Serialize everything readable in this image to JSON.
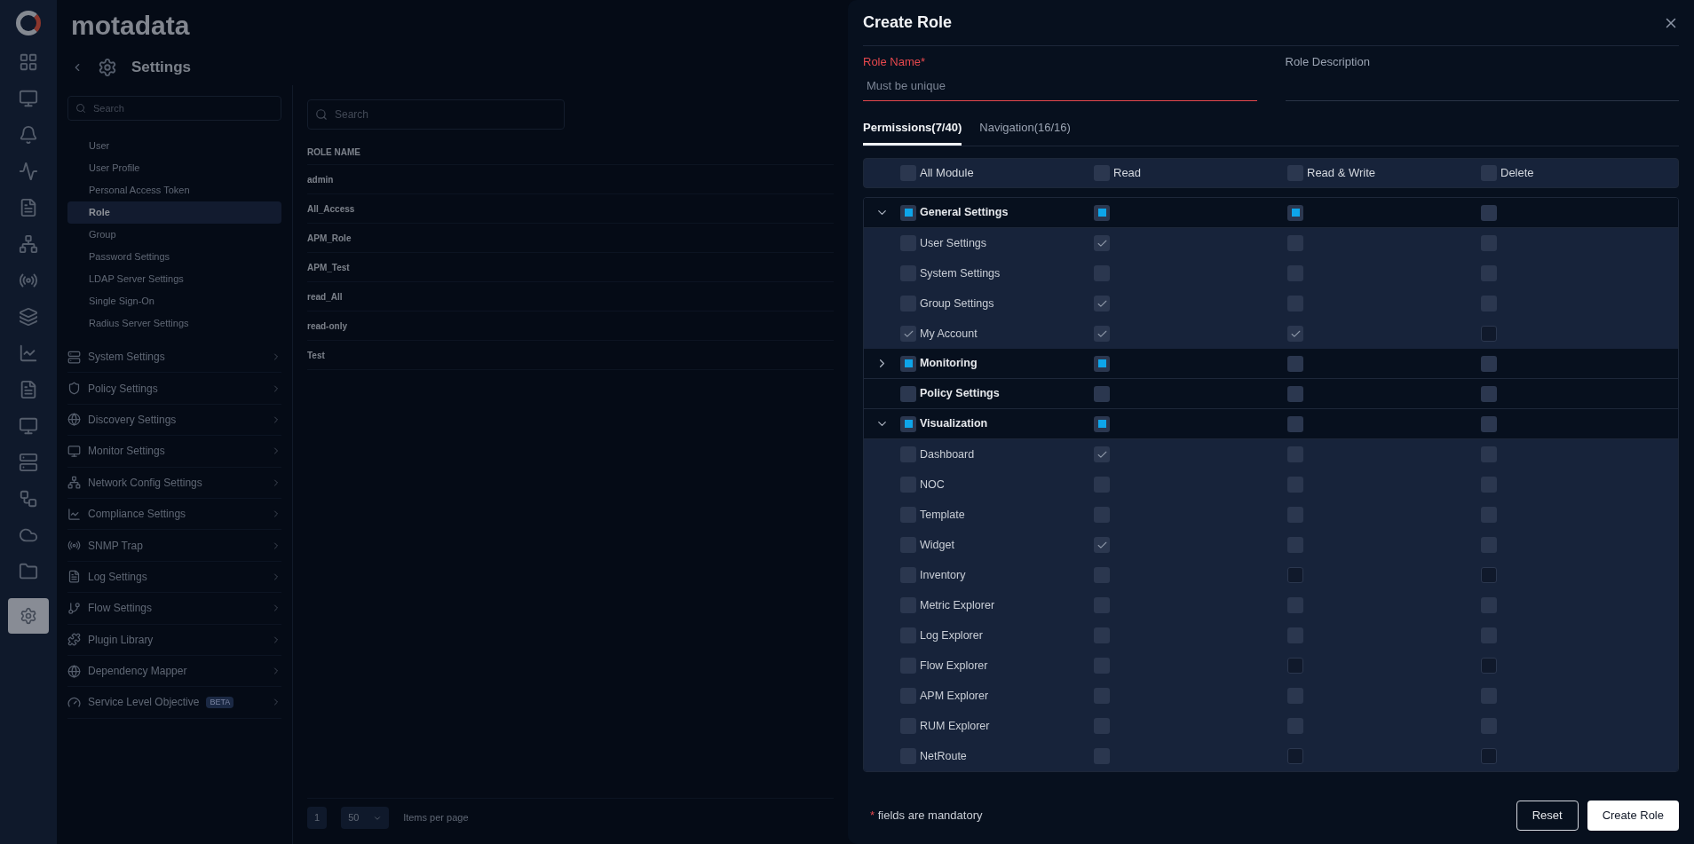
{
  "background": {
    "logo": "motadata",
    "page_title": "Settings",
    "nav_search": {
      "placeholder": "Search"
    },
    "nav_items": [
      {
        "label": "User",
        "selected": false
      },
      {
        "label": "User Profile",
        "selected": false
      },
      {
        "label": "Personal Access Token",
        "selected": false
      },
      {
        "label": "Role",
        "selected": true
      },
      {
        "label": "Group",
        "selected": false
      },
      {
        "label": "Password Settings",
        "selected": false
      },
      {
        "label": "LDAP Server Settings",
        "selected": false
      },
      {
        "label": "Single Sign-On",
        "selected": false
      },
      {
        "label": "Radius Server Settings",
        "selected": false
      }
    ],
    "nav_groups": [
      {
        "label": "System Settings"
      },
      {
        "label": "Policy Settings"
      },
      {
        "label": "Discovery Settings"
      },
      {
        "label": "Monitor Settings"
      },
      {
        "label": "Network Config Settings"
      },
      {
        "label": "Compliance Settings"
      },
      {
        "label": "SNMP Trap"
      },
      {
        "label": "Log Settings"
      },
      {
        "label": "Flow Settings"
      },
      {
        "label": "Plugin Library"
      },
      {
        "label": "Dependency Mapper"
      },
      {
        "label": "Service Level Objective",
        "badge": "BETA"
      }
    ],
    "table_search": {
      "placeholder": "Search"
    },
    "column": "ROLE NAME",
    "rows": [
      "admin",
      "All_Access",
      "APM_Role",
      "APM_Test",
      "read_All",
      "read-only",
      "Test"
    ],
    "pagination": {
      "page": "1",
      "page_size": "50",
      "label": "Items per page"
    }
  },
  "drawer": {
    "title": "Create Role",
    "fields": [
      {
        "label": "Role Name",
        "required": true,
        "placeholder": "Must be unique"
      },
      {
        "label": "Role Description",
        "required": false
      }
    ],
    "tabs": [
      {
        "label": "Permissions(7/40)",
        "selected": true
      },
      {
        "label": "Navigation(16/16)",
        "selected": false
      }
    ],
    "header": [
      {
        "label": "All Module",
        "checked": false
      },
      {
        "label": "Read",
        "checked": false
      },
      {
        "label": "Read & Write",
        "checked": false
      },
      {
        "label": "Delete",
        "checked": false
      }
    ],
    "permissions": [
      {
        "kind": "group",
        "name": "General Settings",
        "expanded": true,
        "checks": [
          {
            "checked": true,
            "partial": true,
            "disabled": false
          },
          {
            "checked": true,
            "partial": true,
            "disabled": false
          },
          {
            "checked": true,
            "partial": true,
            "disabled": false
          },
          {
            "checked": false,
            "partial": false,
            "disabled": false
          }
        ]
      },
      {
        "kind": "child",
        "name": "User Settings",
        "checks": [
          {
            "checked": false,
            "partial": false,
            "disabled": false
          },
          {
            "checked": true,
            "partial": false,
            "disabled": false
          },
          {
            "checked": false,
            "partial": false,
            "disabled": false
          },
          {
            "checked": false,
            "partial": false,
            "disabled": false
          }
        ]
      },
      {
        "kind": "child",
        "name": "System Settings",
        "checks": [
          {
            "checked": false,
            "partial": false,
            "disabled": false
          },
          {
            "checked": false,
            "partial": false,
            "disabled": false
          },
          {
            "checked": false,
            "partial": false,
            "disabled": false
          },
          {
            "checked": false,
            "partial": false,
            "disabled": false
          }
        ]
      },
      {
        "kind": "child",
        "name": "Group Settings",
        "checks": [
          {
            "checked": false,
            "partial": false,
            "disabled": false
          },
          {
            "checked": true,
            "partial": false,
            "disabled": false
          },
          {
            "checked": false,
            "partial": false,
            "disabled": false
          },
          {
            "checked": false,
            "partial": false,
            "disabled": false
          }
        ]
      },
      {
        "kind": "child",
        "name": "My Account",
        "checks": [
          {
            "checked": true,
            "partial": false,
            "disabled": false
          },
          {
            "checked": true,
            "partial": false,
            "disabled": false
          },
          {
            "checked": true,
            "partial": false,
            "disabled": false
          },
          {
            "checked": false,
            "partial": false,
            "disabled": true
          }
        ]
      },
      {
        "kind": "group",
        "name": "Monitoring",
        "expanded": false,
        "checks": [
          {
            "checked": true,
            "partial": true,
            "disabled": false
          },
          {
            "checked": true,
            "partial": true,
            "disabled": false
          },
          {
            "checked": false,
            "partial": false,
            "disabled": false
          },
          {
            "checked": false,
            "partial": false,
            "disabled": false
          }
        ]
      },
      {
        "kind": "group",
        "name": "Policy Settings",
        "checks": [
          {
            "checked": false,
            "partial": false,
            "disabled": false
          },
          {
            "checked": false,
            "partial": false,
            "disabled": false
          },
          {
            "checked": false,
            "partial": false,
            "disabled": false
          },
          {
            "checked": false,
            "partial": false,
            "disabled": false
          }
        ]
      },
      {
        "kind": "group",
        "name": "Visualization",
        "expanded": true,
        "checks": [
          {
            "checked": true,
            "partial": true,
            "disabled": false
          },
          {
            "checked": true,
            "partial": true,
            "disabled": false
          },
          {
            "checked": false,
            "partial": false,
            "disabled": false
          },
          {
            "checked": false,
            "partial": false,
            "disabled": false
          }
        ]
      },
      {
        "kind": "child",
        "name": "Dashboard",
        "checks": [
          {
            "checked": false,
            "partial": false,
            "disabled": false
          },
          {
            "checked": true,
            "partial": false,
            "disabled": false
          },
          {
            "checked": false,
            "partial": false,
            "disabled": false
          },
          {
            "checked": false,
            "partial": false,
            "disabled": false
          }
        ]
      },
      {
        "kind": "child",
        "name": "NOC",
        "checks": [
          {
            "checked": false,
            "partial": false,
            "disabled": false
          },
          {
            "checked": false,
            "partial": false,
            "disabled": false
          },
          {
            "checked": false,
            "partial": false,
            "disabled": false
          },
          {
            "checked": false,
            "partial": false,
            "disabled": false
          }
        ]
      },
      {
        "kind": "child",
        "name": "Template",
        "checks": [
          {
            "checked": false,
            "partial": false,
            "disabled": false
          },
          {
            "checked": false,
            "partial": false,
            "disabled": false
          },
          {
            "checked": false,
            "partial": false,
            "disabled": false
          },
          {
            "checked": false,
            "partial": false,
            "disabled": false
          }
        ]
      },
      {
        "kind": "child",
        "name": "Widget",
        "checks": [
          {
            "checked": false,
            "partial": false,
            "disabled": false
          },
          {
            "checked": true,
            "partial": false,
            "disabled": false
          },
          {
            "checked": false,
            "partial": false,
            "disabled": false
          },
          {
            "checked": false,
            "partial": false,
            "disabled": false
          }
        ]
      },
      {
        "kind": "child",
        "name": "Inventory",
        "checks": [
          {
            "checked": false,
            "partial": false,
            "disabled": false
          },
          {
            "checked": false,
            "partial": false,
            "disabled": false
          },
          {
            "checked": false,
            "partial": false,
            "disabled": true
          },
          {
            "checked": false,
            "partial": false,
            "disabled": true
          }
        ]
      },
      {
        "kind": "child",
        "name": "Metric Explorer",
        "checks": [
          {
            "checked": false,
            "partial": false,
            "disabled": false
          },
          {
            "checked": false,
            "partial": false,
            "disabled": false
          },
          {
            "checked": false,
            "partial": false,
            "disabled": false
          },
          {
            "checked": false,
            "partial": false,
            "disabled": false
          }
        ]
      },
      {
        "kind": "child",
        "name": "Log Explorer",
        "checks": [
          {
            "checked": false,
            "partial": false,
            "disabled": false
          },
          {
            "checked": false,
            "partial": false,
            "disabled": false
          },
          {
            "checked": false,
            "partial": false,
            "disabled": false
          },
          {
            "checked": false,
            "partial": false,
            "disabled": false
          }
        ]
      },
      {
        "kind": "child",
        "name": "Flow Explorer",
        "checks": [
          {
            "checked": false,
            "partial": false,
            "disabled": false
          },
          {
            "checked": false,
            "partial": false,
            "disabled": false
          },
          {
            "checked": false,
            "partial": false,
            "disabled": true
          },
          {
            "checked": false,
            "partial": false,
            "disabled": true
          }
        ]
      },
      {
        "kind": "child",
        "name": "APM Explorer",
        "checks": [
          {
            "checked": false,
            "partial": false,
            "disabled": false
          },
          {
            "checked": false,
            "partial": false,
            "disabled": false
          },
          {
            "checked": false,
            "partial": false,
            "disabled": false
          },
          {
            "checked": false,
            "partial": false,
            "disabled": false
          }
        ]
      },
      {
        "kind": "child",
        "name": "RUM Explorer",
        "checks": [
          {
            "checked": false,
            "partial": false,
            "disabled": false
          },
          {
            "checked": false,
            "partial": false,
            "disabled": false
          },
          {
            "checked": false,
            "partial": false,
            "disabled": false
          },
          {
            "checked": false,
            "partial": false,
            "disabled": false
          }
        ]
      },
      {
        "kind": "child",
        "name": "NetRoute",
        "checks": [
          {
            "checked": false,
            "partial": false,
            "disabled": false
          },
          {
            "checked": false,
            "partial": false,
            "disabled": false
          },
          {
            "checked": false,
            "partial": false,
            "disabled": true
          },
          {
            "checked": false,
            "partial": false,
            "disabled": true
          }
        ]
      }
    ],
    "mandatory_note": {
      "mark": "*",
      "text": "fields are mandatory"
    },
    "buttons": [
      {
        "label": "Reset",
        "kind": "secondary"
      },
      {
        "label": "Create Role",
        "kind": "primary"
      }
    ]
  }
}
